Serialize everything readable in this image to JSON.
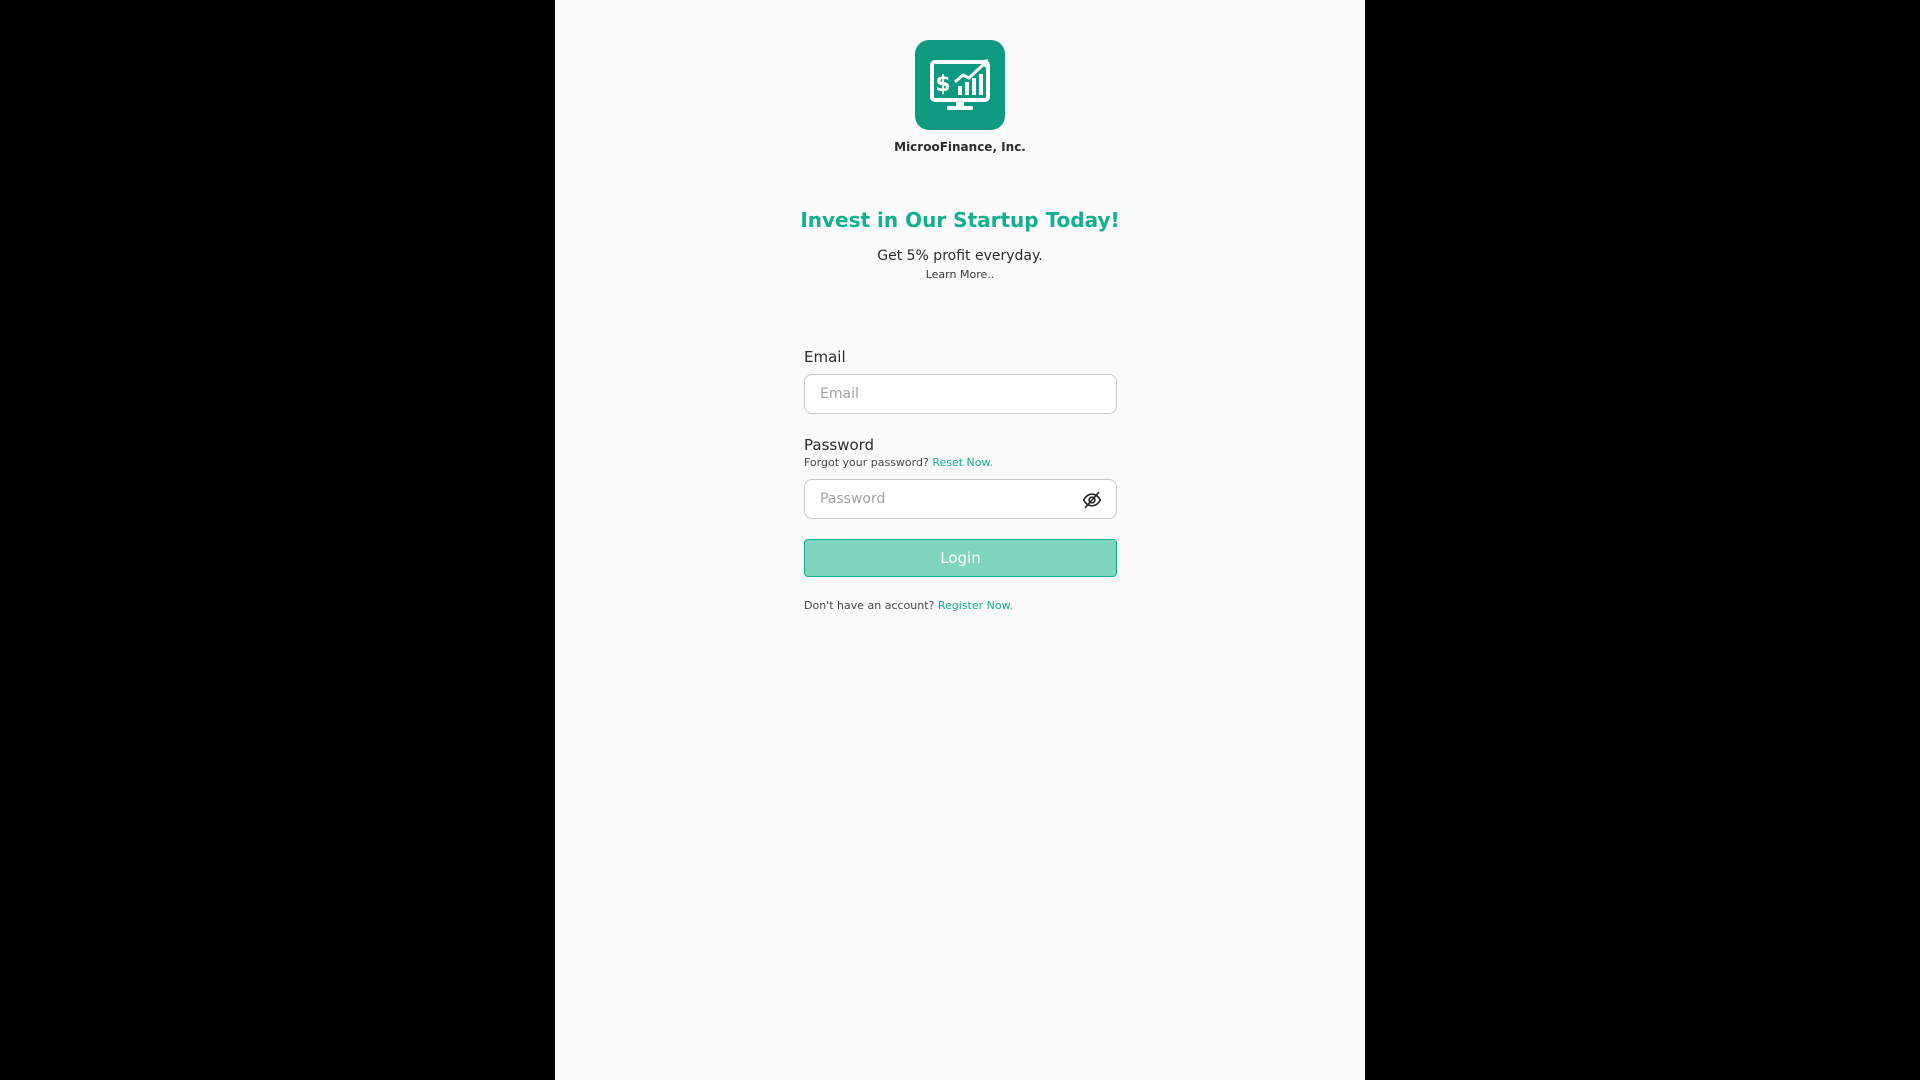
{
  "brand": {
    "company_name": "MicrooFinance, Inc.",
    "logo_icon": "monitor-dollar-chart-icon",
    "logo_color": "#0e9a7e",
    "accent_color": "#13b08d"
  },
  "hero": {
    "headline": "Invest in Our Startup Today!",
    "subhead": "Get 5% profit everyday.",
    "learn_more": "Learn More.."
  },
  "form": {
    "email_label": "Email",
    "email_placeholder": "Email",
    "email_value": "",
    "password_label": "Password",
    "forgot_text": "Forgot your password?",
    "reset_link": "Reset Now.",
    "password_placeholder": "Password",
    "password_value": "",
    "toggle_icon": "eye-off-icon",
    "login_label": "Login",
    "no_account_text": "Don't have an account?",
    "register_link": "Register Now."
  }
}
